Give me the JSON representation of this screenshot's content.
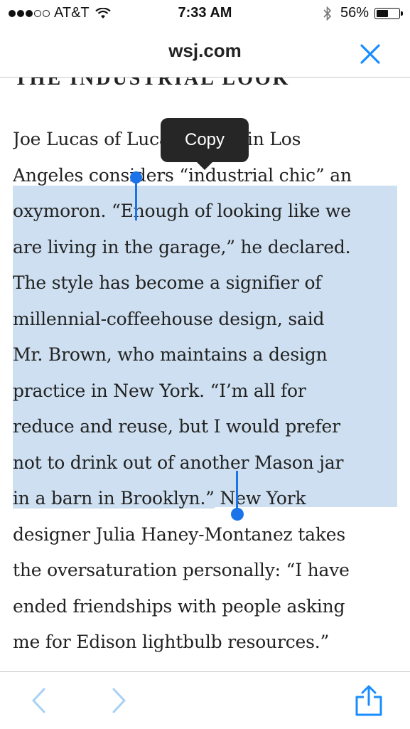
{
  "status_bar": {
    "carrier": "AT&T",
    "signal_bars_filled": 3,
    "signal_bars_total": 5,
    "time": "7:33 AM",
    "battery_percent": "56%",
    "battery_level": 0.56,
    "icons": [
      "wifi-icon",
      "bluetooth-icon",
      "battery-icon"
    ]
  },
  "nav": {
    "title": "wsj.com",
    "close_icon": "close-icon",
    "accent_color": "#1a8cff"
  },
  "article": {
    "cut_heading": "THE INDUSTRIAL LOOK",
    "lines": [
      "Joe Lucas of Lucas Studio in Los",
      "Angeles considers “industrial chic” an",
      "oxymoron. “",
      "Enough of looking like we",
      "are living in the garage,” he declared.",
      "The style has become a signifier of",
      "millennial-coffeehouse design, said",
      "Mr. Brown, who maintains a design",
      "practice in New York. “I’m all for",
      "reduce and reuse, but I would prefer",
      "not to drink out of another Mason jar",
      "in a barn in Brooklyn.”",
      " New York",
      "designer Julia Haney-Montanez takes",
      "the oversaturation personally: “I have",
      "ended friendships with people asking",
      "me for Edison lightbulb resources.”"
    ],
    "selection_color": "#cddff0",
    "handle_color": "#1a73e8"
  },
  "popup": {
    "copy_label": "Copy"
  },
  "toolbar": {
    "back_icon": "chevron-left-icon",
    "forward_icon": "chevron-right-icon",
    "share_icon": "share-icon",
    "disabled_color": "#a8d0f5",
    "active_color": "#1a8cff"
  }
}
